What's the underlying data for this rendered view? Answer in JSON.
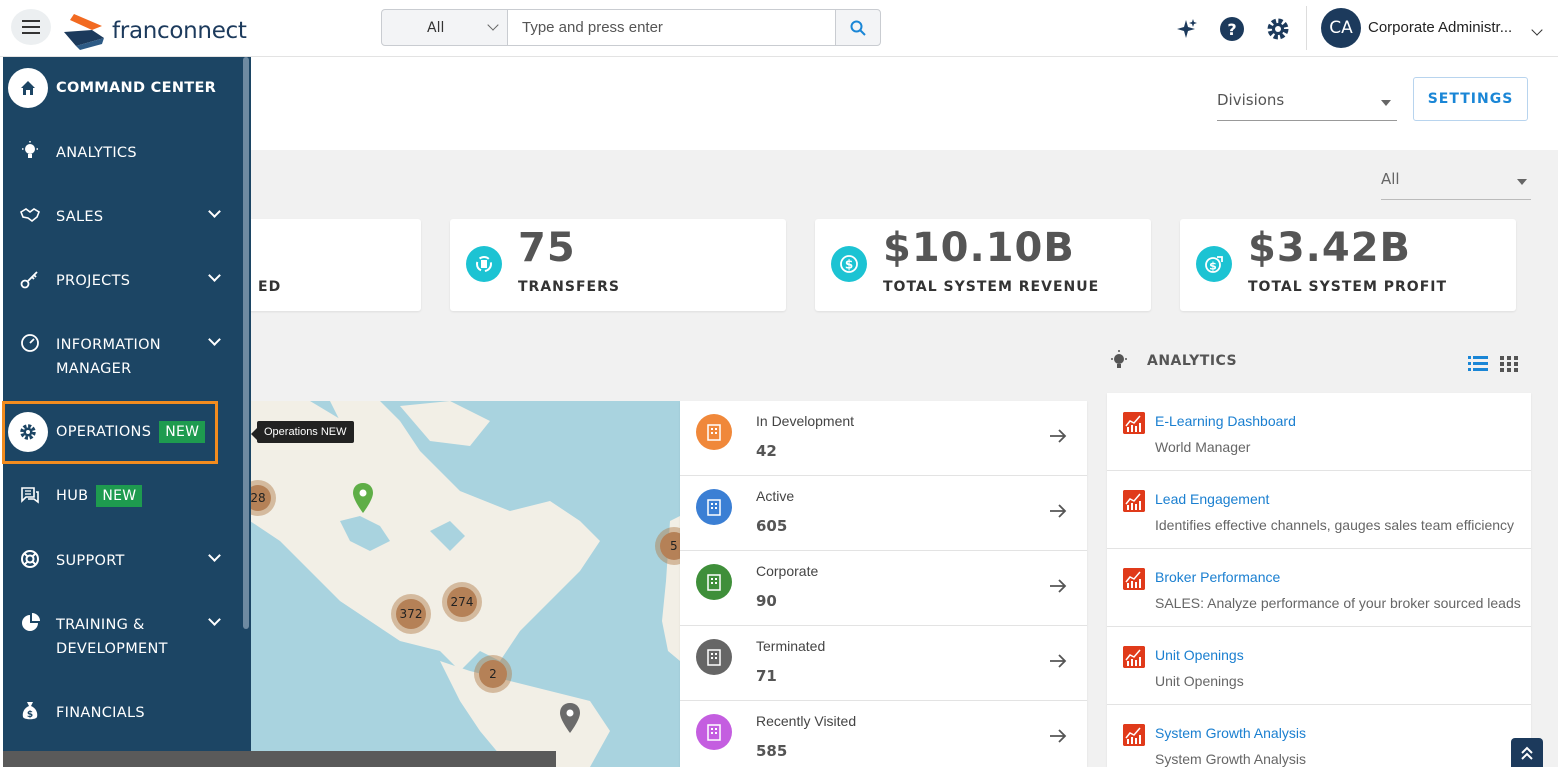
{
  "header": {
    "logo_text": "franconnect",
    "search_category": "All",
    "search_placeholder": "Type and press enter",
    "user_initials": "CA",
    "user_name": "Corporate Administr..."
  },
  "sidebar": {
    "items": [
      {
        "label": "COMMAND CENTER",
        "icon": "home-icon"
      },
      {
        "label": "ANALYTICS",
        "icon": "lightbulb-icon"
      },
      {
        "label": "SALES",
        "icon": "handshake-icon"
      },
      {
        "label": "PROJECTS",
        "icon": "key-icon"
      },
      {
        "label": "INFORMATION",
        "label2": "MANAGER",
        "icon": "gauge-icon"
      },
      {
        "label": "OPERATIONS",
        "badge": "NEW",
        "icon": "gear-icon"
      },
      {
        "label": "HUB",
        "badge": "NEW",
        "icon": "chat-icon"
      },
      {
        "label": "SUPPORT",
        "icon": "lifebuoy-icon"
      },
      {
        "label": "TRAINING &",
        "label2": "DEVELOPMENT",
        "icon": "pie-icon"
      },
      {
        "label": "FINANCIALS",
        "icon": "money-bag-icon"
      }
    ],
    "tooltip": "Operations NEW"
  },
  "toolbar": {
    "divisions_label": "Divisions",
    "settings_label": "SETTINGS",
    "filter_value": "All"
  },
  "stats": [
    {
      "value": "",
      "label": "ED"
    },
    {
      "value": "75",
      "label": "TRANSFERS"
    },
    {
      "value": "$10.10B",
      "label": "TOTAL SYSTEM REVENUE"
    },
    {
      "value": "$3.42B",
      "label": "TOTAL SYSTEM PROFIT"
    }
  ],
  "map": {
    "clusters": [
      "28",
      "372",
      "274",
      "2",
      "5"
    ]
  },
  "status_list": [
    {
      "label": "In Development",
      "count": "42",
      "color": "#f0883a"
    },
    {
      "label": "Active",
      "count": "605",
      "color": "#3b7fd4"
    },
    {
      "label": "Corporate",
      "count": "90",
      "color": "#3f8f3a"
    },
    {
      "label": "Terminated",
      "count": "71",
      "color": "#666666"
    },
    {
      "label": "Recently Visited",
      "count": "585",
      "color": "#c45ee0"
    }
  ],
  "analytics": {
    "title": "ANALYTICS",
    "items": [
      {
        "title": "E-Learning Dashboard",
        "desc": "World Manager"
      },
      {
        "title": "Lead Engagement",
        "desc": "Identifies effective channels, gauges sales team efficiency"
      },
      {
        "title": "Broker Performance",
        "desc": "SALES: Analyze performance of your broker sourced leads"
      },
      {
        "title": "Unit Openings",
        "desc": "Unit Openings"
      },
      {
        "title": "System Growth Analysis",
        "desc": "System Growth Analysis"
      }
    ]
  }
}
